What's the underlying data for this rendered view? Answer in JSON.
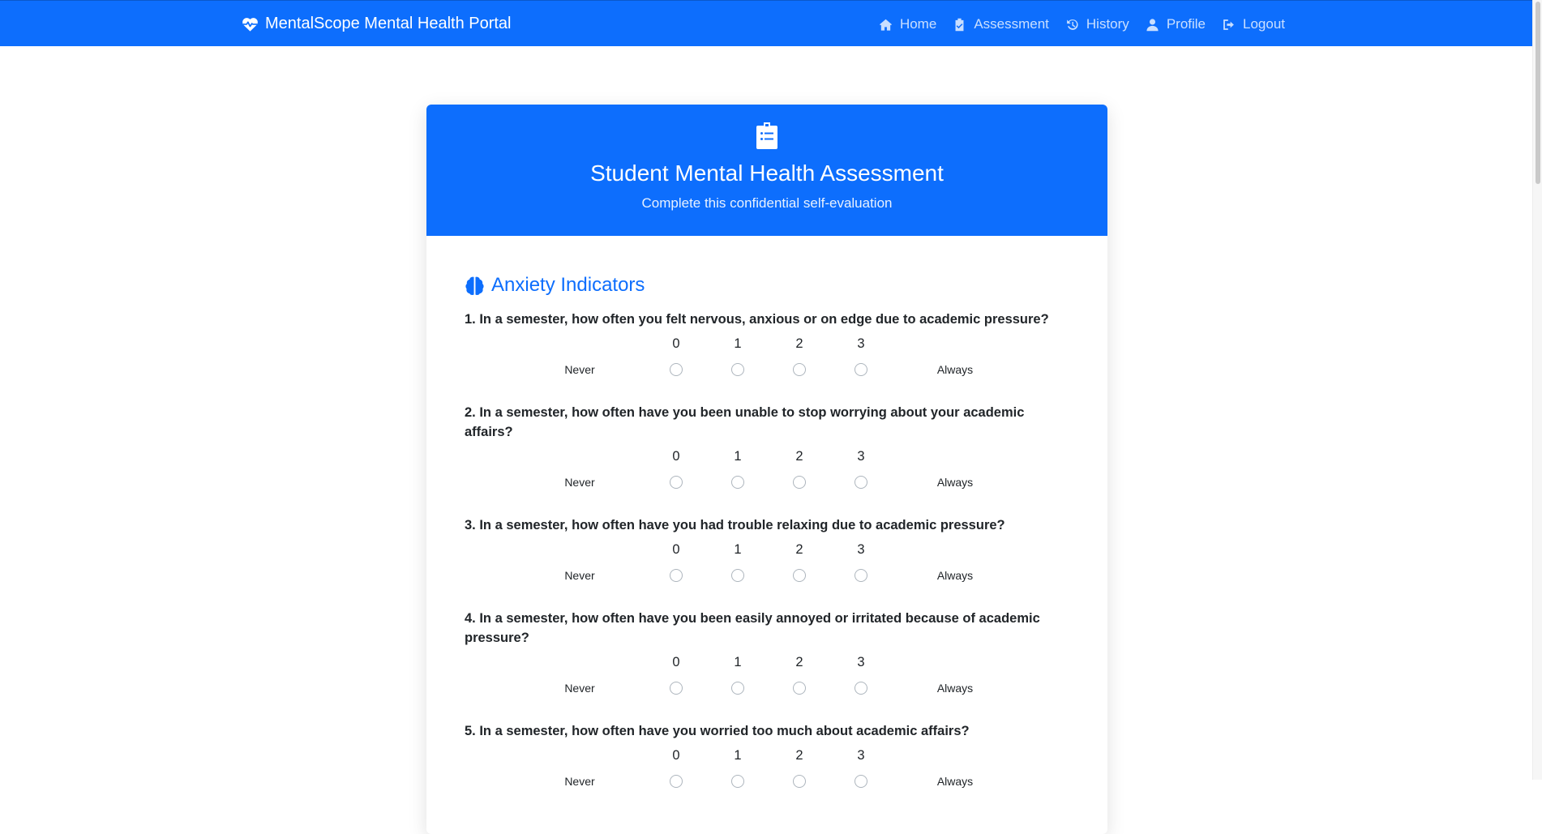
{
  "nav": {
    "brand": "MentalScope Mental Health Portal",
    "links": [
      {
        "label": "Home",
        "icon": "home-icon"
      },
      {
        "label": "Assessment",
        "icon": "clipboard-check-icon"
      },
      {
        "label": "History",
        "icon": "history-icon"
      },
      {
        "label": "Profile",
        "icon": "user-icon"
      },
      {
        "label": "Logout",
        "icon": "sign-out-icon"
      }
    ]
  },
  "header": {
    "icon": "clipboard-list-icon",
    "title": "Student Mental Health Assessment",
    "subtitle": "Complete this confidential self-evaluation"
  },
  "section": {
    "icon": "brain-icon",
    "title": "Anxiety Indicators"
  },
  "scale": {
    "values": [
      "0",
      "1",
      "2",
      "3"
    ],
    "min_label": "Never",
    "max_label": "Always"
  },
  "questions": [
    {
      "text": "1. In a semester, how often you felt nervous, anxious or on edge due to academic pressure?"
    },
    {
      "text": "2. In a semester, how often have you been unable to stop worrying about your academic affairs?"
    },
    {
      "text": "3. In a semester, how often have you had trouble relaxing due to academic pressure?"
    },
    {
      "text": "4. In a semester, how often have you been easily annoyed or irritated because of academic pressure?"
    },
    {
      "text": "5. In a semester, how often have you worried too much about academic affairs?"
    }
  ],
  "colors": {
    "primary": "#0d6efd",
    "text": "#212529"
  }
}
